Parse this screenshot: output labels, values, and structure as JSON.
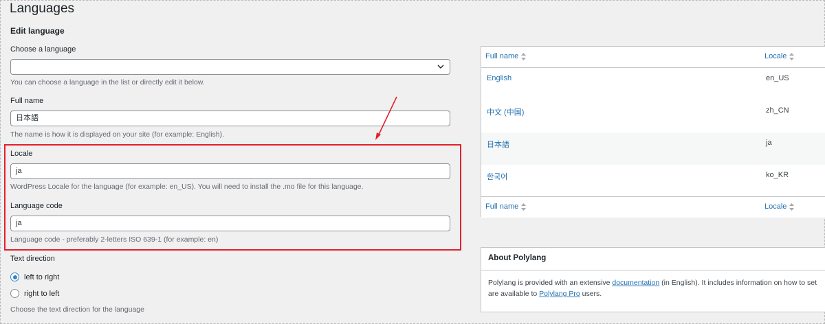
{
  "page": {
    "title": "Languages"
  },
  "form": {
    "section_title": "Edit language",
    "choose": {
      "label": "Choose a language",
      "value": "",
      "help": "You can choose a language in the list or directly edit it below."
    },
    "full_name": {
      "label": "Full name",
      "value": "日本語",
      "help": "The name is how it is displayed on your site (for example: English)."
    },
    "locale": {
      "label": "Locale",
      "value": "ja",
      "help": "WordPress Locale for the language (for example: en_US). You will need to install the .mo file for this language."
    },
    "language_code": {
      "label": "Language code",
      "value": "ja",
      "help": "Language code - preferably 2-letters ISO 639-1 (for example: en)"
    },
    "text_direction": {
      "label": "Text direction",
      "options": [
        "left to right",
        "right to left"
      ],
      "selected": "left to right",
      "help": "Choose the text direction for the language"
    }
  },
  "table": {
    "columns": {
      "full_name": "Full name",
      "locale": "Locale"
    },
    "rows": [
      {
        "name": "English",
        "locale": "en_US"
      },
      {
        "name": "中文 (中国)",
        "locale": "zh_CN"
      },
      {
        "name": "日本語",
        "locale": "ja"
      },
      {
        "name": "한국어",
        "locale": "ko_KR"
      }
    ]
  },
  "about": {
    "title": "About Polylang",
    "line1_before": "Polylang is provided with an extensive ",
    "line1_link": "documentation",
    "line1_after": " (in English). It includes information on how to set",
    "line2_before": "are available to ",
    "line2_link": "Polylang Pro",
    "line2_after": " users."
  },
  "annotation": {
    "highlight_color": "#e4202a"
  },
  "colors": {
    "link": "#2271b1",
    "radio_accent": "#3582c4"
  }
}
